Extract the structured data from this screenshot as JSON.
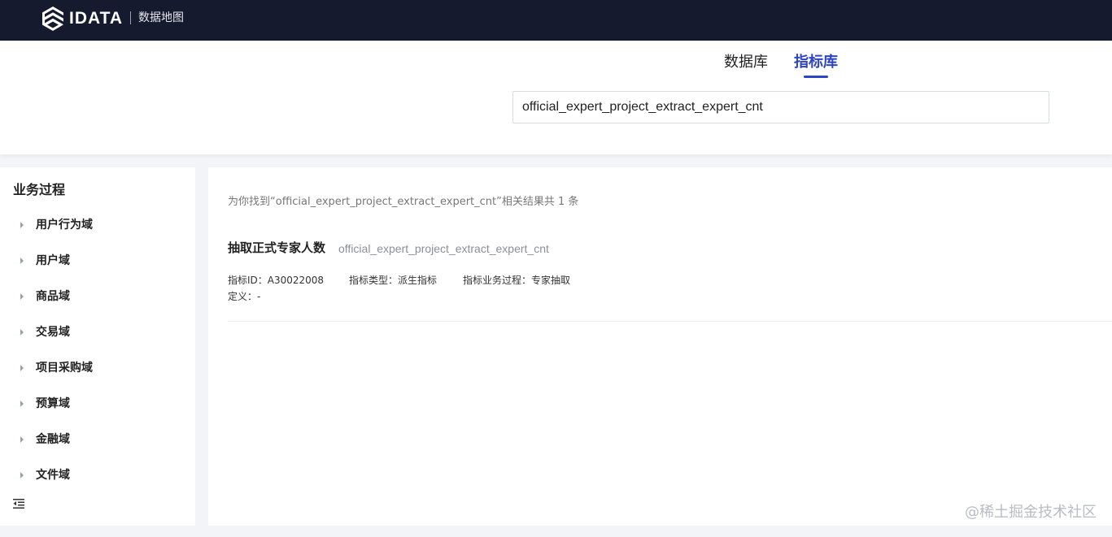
{
  "topbar": {
    "brand": "IDATA",
    "subtitle": "数据地图",
    "logo_icon": "idata-logo-icon"
  },
  "tabs": [
    {
      "label": "数据库",
      "active": false
    },
    {
      "label": "指标库",
      "active": true
    }
  ],
  "search": {
    "value": "official_expert_project_extract_expert_cnt"
  },
  "sidebar": {
    "title": "业务过程",
    "items": [
      {
        "label": "用户行为域"
      },
      {
        "label": "用户域"
      },
      {
        "label": "商品域"
      },
      {
        "label": "交易域"
      },
      {
        "label": "项目采购域"
      },
      {
        "label": "预算域"
      },
      {
        "label": "金融域"
      },
      {
        "label": "文件域"
      }
    ],
    "collapse_icon": "menu-fold-icon"
  },
  "results": {
    "summary": "为你找到“official_expert_project_extract_expert_cnt”相关结果共 1 条",
    "items": [
      {
        "title": "抽取正式专家人数",
        "code": "official_expert_project_extract_expert_cnt",
        "metric_id": "指标ID：A30022008",
        "metric_type": "指标类型：派生指标",
        "business_process": "指标业务过程：专家抽取",
        "definition": "定义：-"
      }
    ]
  },
  "watermark": "@稀土掘金技术社区",
  "colors": {
    "topbar_bg": "#161a2e",
    "accent": "#2c44c6",
    "page_bg": "#f2f4f8"
  }
}
